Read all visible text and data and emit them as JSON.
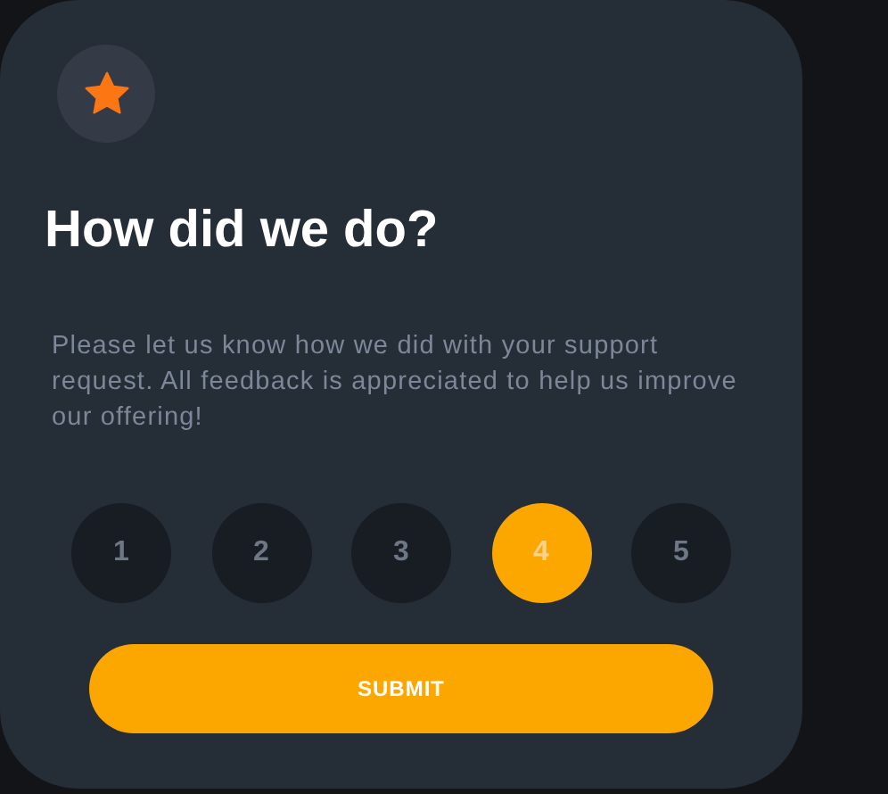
{
  "title": "How did we do?",
  "description": "Please let us know how we did with your support request. All feedback is appreciated to help us improve our offering!",
  "ratings": [
    {
      "label": "1",
      "selected": false
    },
    {
      "label": "2",
      "selected": false
    },
    {
      "label": "3",
      "selected": false
    },
    {
      "label": "4",
      "selected": true
    },
    {
      "label": "5",
      "selected": false
    }
  ],
  "submit": "SUBMIT"
}
